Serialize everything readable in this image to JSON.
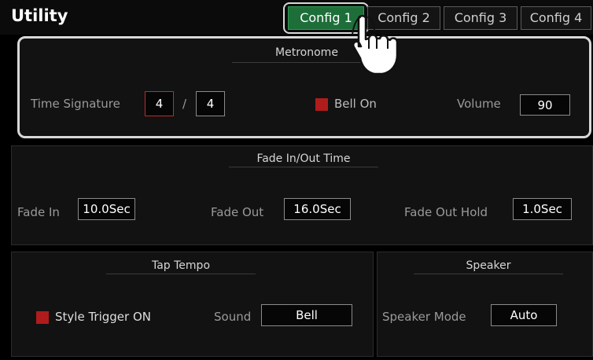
{
  "header": {
    "title": "Utility",
    "tabs": [
      {
        "label": "Config 1"
      },
      {
        "label": "Config 2"
      },
      {
        "label": "Config 3"
      },
      {
        "label": "Config 4"
      }
    ]
  },
  "metronome": {
    "title": "Metronome",
    "time_signature_label": "Time Signature",
    "numerator": "4",
    "slash": "/",
    "denominator": "4",
    "bell_label": "Bell On",
    "volume_label": "Volume",
    "volume_value": "90"
  },
  "fade": {
    "title": "Fade In/Out Time",
    "fade_in_label": "Fade In",
    "fade_in_value": "10.0Sec",
    "fade_out_label": "Fade Out",
    "fade_out_value": "16.0Sec",
    "fade_out_hold_label": "Fade Out Hold",
    "fade_out_hold_value": "1.0Sec"
  },
  "tap_tempo": {
    "title": "Tap Tempo",
    "style_trigger_label": "Style Trigger ON",
    "sound_label": "Sound",
    "sound_value": "Bell"
  },
  "speaker": {
    "title": "Speaker",
    "mode_label": "Speaker Mode",
    "mode_value": "Auto"
  },
  "colors": {
    "active_tab": "#1e6e3a",
    "checkbox": "#b01c1c",
    "highlight_outline": "#d8d8d8"
  }
}
